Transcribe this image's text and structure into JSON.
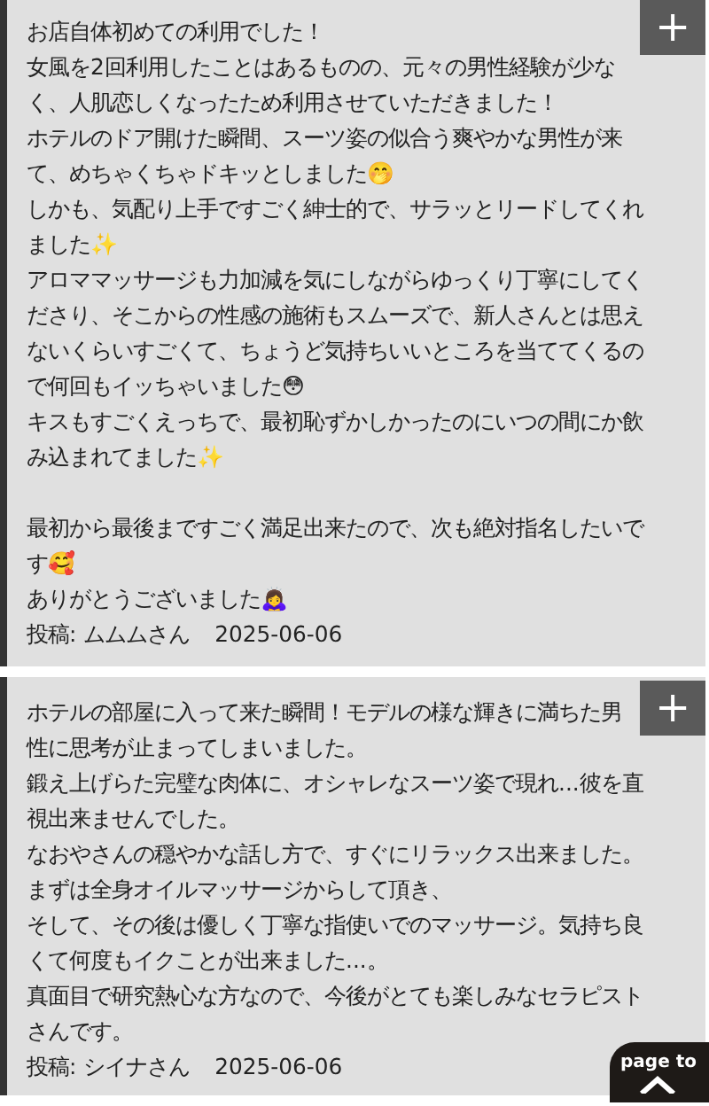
{
  "reviews": [
    {
      "blocks": [
        [
          "お店自体初めての利用でした！",
          "女風を2回利用したことはあるものの、元々の男性経験が少なく、人肌恋しくなったため利用させていただきました！",
          "ホテルのドア開けた瞬間、スーツ姿の似合う爽やかな男性が来て、めちゃくちゃドキッとしました🤭",
          "しかも、気配り上手ですごく紳士的で、サラッとリードしてくれました✨",
          "アロママッサージも力加減を気にしながらゆっくり丁寧にしてくださり、そこからの性感の施術もスムーズで、新人さんとは思えないくらいすごくて、ちょうど気持ちいいところを当ててくるので何回もイッちゃいました😳",
          "キスもすごくえっちで、最初恥ずかしかったのにいつの間にか飲み込まれてました✨"
        ],
        [
          "最初から最後まですごく満足出来たので、次も絶対指名したいです🥰",
          "ありがとうございました🙇‍♀️"
        ]
      ],
      "author": "投稿: ムムムさん",
      "date": "2025-06-06",
      "expand": "+"
    },
    {
      "blocks": [
        [
          "ホテルの部屋に入って来た瞬間！モデルの様な輝きに満ちた男性に思考が止まってしまいました。",
          "鍛え上げらた完璧な肉体に、オシャレなスーツ姿で現れ...彼を直視出来ませんでした。",
          "なおやさんの穏やかな話し方で、すぐにリラックス出来ました。",
          "まずは全身オイルマッサージからして頂き、",
          "そして、その後は優しく丁寧な指使いでのマッサージ。気持ち良くて何度もイクことが出来ました...。",
          "真面目で研究熱心な方なので、今後がとても楽しみなセラピストさんです。"
        ]
      ],
      "author": "投稿: シイナさん",
      "date": "2025-06-06",
      "expand": "+"
    }
  ],
  "page_top": {
    "label": "page to"
  }
}
